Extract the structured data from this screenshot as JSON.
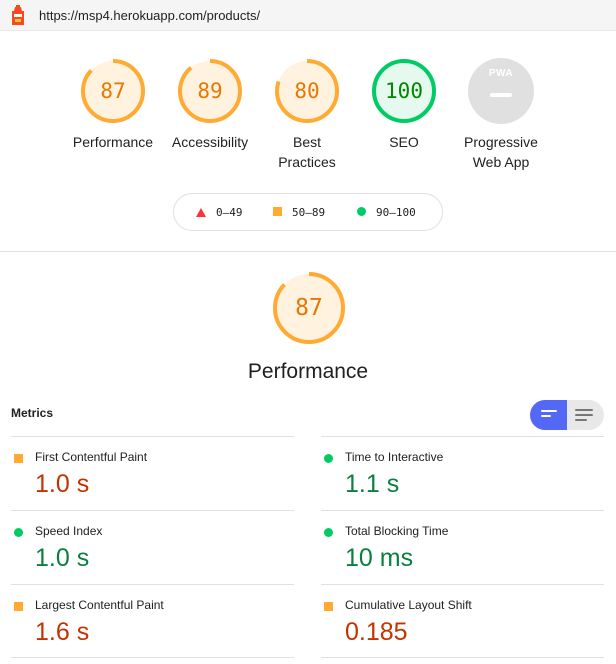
{
  "browser": {
    "url": "https://msp4.herokuapp.com/products/"
  },
  "colors": {
    "average": "#ffaa33",
    "pass": "#00cc66",
    "fail": "#ff3333",
    "average_text": "#e67700",
    "pass_text": "#008800",
    "toggle_active": "#5468f6"
  },
  "gauges": [
    {
      "score": "87",
      "label": "Performance",
      "rating": "average"
    },
    {
      "score": "89",
      "label": "Accessibility",
      "rating": "average"
    },
    {
      "score": "80",
      "label": "Best Practices",
      "rating": "average"
    },
    {
      "score": "100",
      "label": "SEO",
      "rating": "pass"
    },
    {
      "badge": "PWA",
      "label": "Progressive Web App",
      "rating": "na"
    }
  ],
  "legend": {
    "fail_range": "0–49",
    "average_range": "50–89",
    "pass_range": "90–100"
  },
  "performance": {
    "score": "87",
    "title": "Performance"
  },
  "metrics": {
    "heading": "Metrics",
    "view_toggle_icons": [
      "list-view-icon",
      "detailed-view-icon"
    ],
    "items": [
      {
        "name": "First Contentful Paint",
        "value": "1.0 s",
        "rating": "average"
      },
      {
        "name": "Time to Interactive",
        "value": "1.1 s",
        "rating": "pass"
      },
      {
        "name": "Speed Index",
        "value": "1.0 s",
        "rating": "pass"
      },
      {
        "name": "Total Blocking Time",
        "value": "10 ms",
        "rating": "pass"
      },
      {
        "name": "Largest Contentful Paint",
        "value": "1.6 s",
        "rating": "average"
      },
      {
        "name": "Cumulative Layout Shift",
        "value": "0.185",
        "rating": "average"
      }
    ]
  }
}
